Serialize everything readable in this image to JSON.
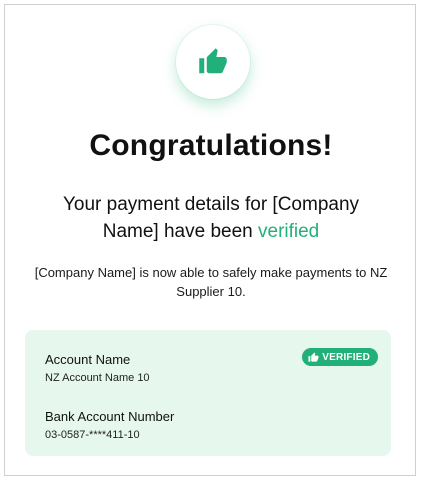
{
  "header": {
    "icon": "thumbs-up-icon",
    "accent_color": "#22b07a"
  },
  "title": "Congratulations!",
  "subtitle": {
    "prefix": "Your payment details for [Company Name] have been ",
    "highlight": "verified"
  },
  "description": "[Company Name] is now able to safely make payments to NZ Supplier 10.",
  "details": {
    "badge_label": "VERIFIED",
    "badge_icon": "thumbs-up-icon",
    "account_name_label": "Account Name",
    "account_name_value": "NZ Account Name 10",
    "bank_account_label": "Bank Account Number",
    "bank_account_value": "03-0587-****411-10",
    "panel_color": "#e6f7ee"
  }
}
